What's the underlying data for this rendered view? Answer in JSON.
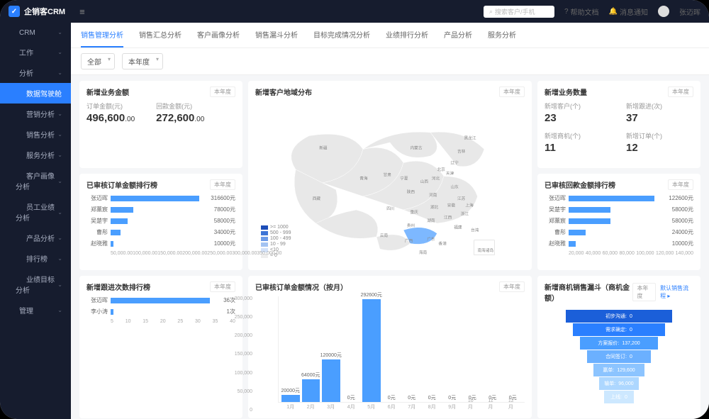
{
  "app": {
    "title": "企销客CRM"
  },
  "topbar": {
    "search_placeholder": "搜索客户/手机",
    "help": "帮助文档",
    "notify": "消息通知",
    "username": "张迈晖"
  },
  "sidebar": {
    "items": [
      {
        "icon": "grid",
        "label": "CRM",
        "expand": true
      },
      {
        "icon": "briefcase",
        "label": "工作",
        "expand": true
      },
      {
        "icon": "gauge",
        "label": "分析",
        "expand": true,
        "open": true
      },
      {
        "icon": "",
        "label": "数据驾驶舱",
        "active": true,
        "l2": true
      },
      {
        "icon": "target",
        "label": "营销分析",
        "expand": true,
        "l2": true
      },
      {
        "icon": "filter",
        "label": "销售分析",
        "expand": true,
        "l2": true
      },
      {
        "icon": "headset",
        "label": "服务分析",
        "expand": true,
        "l2": true
      },
      {
        "icon": "users",
        "label": "客户画像分析",
        "expand": true,
        "l2": true
      },
      {
        "icon": "bar",
        "label": "员工业绩分析",
        "expand": true,
        "l2": true
      },
      {
        "icon": "box",
        "label": "产品分析",
        "expand": true,
        "l2": true
      },
      {
        "icon": "rank",
        "label": "排行榜",
        "expand": true,
        "l2": true
      },
      {
        "icon": "goal",
        "label": "业绩目标分析",
        "expand": true,
        "l2": true
      },
      {
        "icon": "monitor",
        "label": "管理",
        "expand": true
      }
    ]
  },
  "tabs": [
    "销售管理分析",
    "销售汇总分析",
    "客户画像分析",
    "销售漏斗分析",
    "目标完成情况分析",
    "业绩排行分析",
    "产品分析",
    "服务分析"
  ],
  "filters": {
    "dept": "全部",
    "period": "本年度"
  },
  "period_label": "本年度",
  "cards": {
    "amount": {
      "title": "新增业务金额",
      "sub1_label": "订单金额(元)",
      "sub1_val": "496,600",
      "sub1_dec": ".00",
      "sub2_label": "回款金额(元)",
      "sub2_val": "272,600",
      "sub2_dec": ".00"
    },
    "region": {
      "title": "新增客户地域分布"
    },
    "count": {
      "title": "新增业务数量",
      "stats": [
        {
          "label": "新增客户(个)",
          "val": "23"
        },
        {
          "label": "新增跟进(次)",
          "val": "37"
        },
        {
          "label": "新增商机(个)",
          "val": "11"
        },
        {
          "label": "新增订单(个)",
          "val": "12"
        }
      ]
    },
    "order_rank": {
      "title": "已审核订单金额排行榜"
    },
    "payment_rank": {
      "title": "已审核回款金额排行榜"
    },
    "follow_rank": {
      "title": "新增跟进次数排行榜"
    },
    "monthly": {
      "title": "已审核订单金额情况（按月）"
    },
    "funnel": {
      "title": "新增商机销售漏斗（商机金额）",
      "link": "默认销售流程"
    }
  },
  "map_legend": [
    {
      "color": "#1c4db8",
      "label": ">= 1000"
    },
    {
      "color": "#3d74d6",
      "label": "500 - 999"
    },
    {
      "color": "#6b9ae8",
      "label": "100 - 499"
    },
    {
      "color": "#a3c3f2",
      "label": "10 - 99"
    },
    {
      "color": "#d3e2f9",
      "label": "<10"
    },
    {
      "color": "#eeeeee",
      "label": "= 0"
    }
  ],
  "map_provinces": [
    "黑龙江",
    "吉林",
    "辽宁",
    "内蒙古",
    "新疆",
    "西藏",
    "青海",
    "甘肃",
    "宁夏",
    "陕西",
    "山西",
    "河北",
    "北京",
    "天津",
    "山东",
    "河南",
    "江苏",
    "安徽",
    "上海",
    "湖北",
    "重庆",
    "四川",
    "贵州",
    "云南",
    "湖南",
    "江西",
    "浙江",
    "福建",
    "广东",
    "广西",
    "海南",
    "台湾",
    "香港",
    "南海诸岛"
  ],
  "chart_data": {
    "order_rank": {
      "type": "bar",
      "orientation": "horizontal",
      "categories": [
        "张迈晖",
        "郑薰宸",
        "吴楚宇",
        "曹彤",
        "赵晓雅"
      ],
      "values": [
        316600,
        78000,
        58000,
        34000,
        10000
      ],
      "xlim": [
        0,
        350000
      ],
      "xticks": [
        "50,000.00",
        "100,000.00",
        "150,000.00",
        "200,000.00",
        "250,000.00",
        "300,000.00",
        "350,000.00"
      ],
      "unit": "元"
    },
    "payment_rank": {
      "type": "bar",
      "orientation": "horizontal",
      "categories": [
        "张迈晖",
        "吴楚宇",
        "郑薰宸",
        "曹彤",
        "赵晓雅"
      ],
      "values": [
        122600,
        58000,
        58000,
        24000,
        10000
      ],
      "xlim": [
        0,
        140000
      ],
      "xticks": [
        "20,000",
        "40,000",
        "60,000",
        "80,000",
        "100,000",
        "120,000",
        "140,000"
      ],
      "unit": "元"
    },
    "follow_rank": {
      "type": "bar",
      "orientation": "horizontal",
      "categories": [
        "张迈晖",
        "李小涛"
      ],
      "values": [
        36,
        1
      ],
      "xlim": [
        0,
        40
      ],
      "xticks": [
        "5",
        "10",
        "15",
        "20",
        "25",
        "30",
        "35",
        "40"
      ],
      "unit": "次"
    },
    "monthly": {
      "type": "bar",
      "categories": [
        "1月",
        "2月",
        "3月",
        "4月",
        "5月",
        "6月",
        "7月",
        "8月",
        "9月",
        "10月",
        "11月",
        "12月"
      ],
      "values": [
        20000,
        64000,
        120000,
        0,
        292600,
        0,
        0,
        0,
        0,
        0,
        0,
        0
      ],
      "ylim": [
        0,
        300000
      ],
      "yticks": [
        "0",
        "50,000",
        "100,000",
        "150,000",
        "200,000",
        "250,000",
        "300,000"
      ],
      "unit": "元"
    },
    "funnel": {
      "type": "funnel",
      "stages": [
        {
          "label": "初步沟通",
          "value": 0,
          "color": "#1b5fd9",
          "width": 150
        },
        {
          "label": "需求确定",
          "value": 0,
          "color": "#2a7fff",
          "width": 130
        },
        {
          "label": "方案报价",
          "value": 137200,
          "color": "#4a9eff",
          "width": 110
        },
        {
          "label": "合同签订",
          "value": 0,
          "color": "#6bb0ff",
          "width": 90
        },
        {
          "label": "赢单",
          "value": 129600,
          "color": "#8cc4ff",
          "width": 72
        },
        {
          "label": "输单",
          "value": 96000,
          "color": "#add7ff",
          "width": 56
        },
        {
          "label": "上线",
          "value": 0,
          "color": "#cde8ff",
          "width": 42
        }
      ]
    }
  }
}
